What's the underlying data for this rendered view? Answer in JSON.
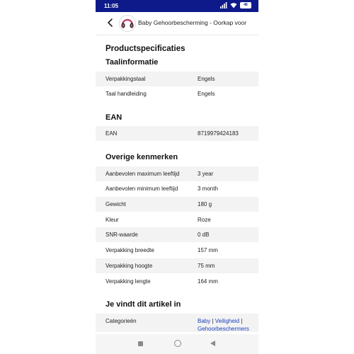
{
  "status": {
    "time": "11:05",
    "battery": "46"
  },
  "appbar": {
    "title": "Baby Gehoorbescherming - Oorkap voor"
  },
  "page": {
    "title": "Productspecificaties",
    "sections": [
      {
        "heading": "Taalinformatie",
        "rows": [
          {
            "key": "Verpakkingstaal",
            "value": "Engels"
          },
          {
            "key": "Taal handleiding",
            "value": "Engels"
          }
        ]
      },
      {
        "heading": "EAN",
        "rows": [
          {
            "key": "EAN",
            "value": "8719979424183"
          }
        ]
      },
      {
        "heading": "Overige kenmerken",
        "rows": [
          {
            "key": "Aanbevolen maximum leeftijd",
            "value": "3 year"
          },
          {
            "key": "Aanbevolen minimum leeftijd",
            "value": "3 month"
          },
          {
            "key": "Gewicht",
            "value": "180 g"
          },
          {
            "key": "Kleur",
            "value": "Roze"
          },
          {
            "key": "SNR-waarde",
            "value": "0 dB"
          },
          {
            "key": "Verpakking breedte",
            "value": "157 mm"
          },
          {
            "key": "Verpakking hoogte",
            "value": "75 mm"
          },
          {
            "key": "Verpakking lengte",
            "value": "164 mm"
          }
        ]
      },
      {
        "heading": "Je vindt dit artikel in",
        "categories_label": "Categorieën",
        "categories": [
          "Baby",
          "Veiligheid",
          "Gehoorbeschermers"
        ],
        "separator": "|"
      }
    ]
  },
  "colors": {
    "statusbar": "#0e1a8a",
    "link": "#1a3fb8",
    "row_shade": "#f3f3f3"
  },
  "icons": {
    "back": "arrow-left-icon",
    "nav": [
      "square-icon",
      "circle-icon",
      "triangle-back-icon"
    ]
  }
}
